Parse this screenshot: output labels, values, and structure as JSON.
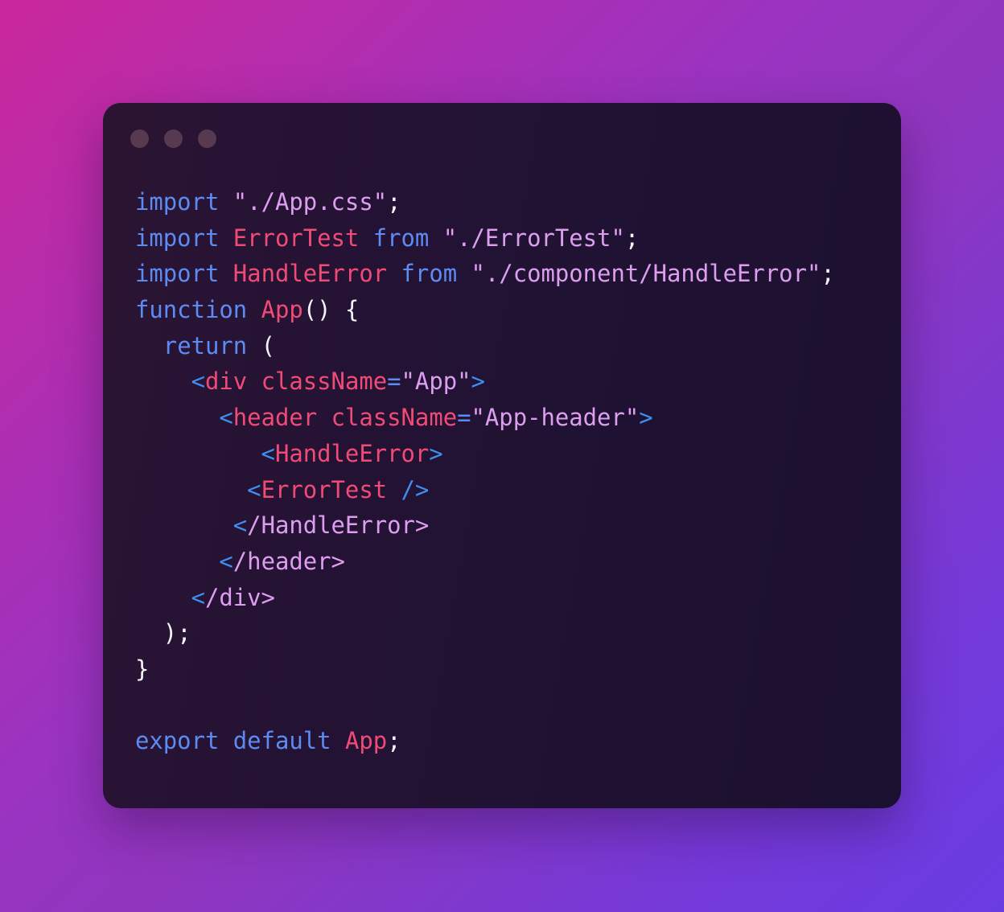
{
  "window": {
    "dots": [
      "close-dot",
      "minimize-dot",
      "maximize-dot"
    ],
    "dot_color": "#573a50"
  },
  "theme": {
    "background_gradient_start": "#c9279b",
    "background_gradient_end": "#693ce2",
    "card_background": "#221233",
    "keyword_color": "#5d8bf4",
    "identifier_color": "#f04b77",
    "string_color": "#dd9ef0",
    "punctuation_color": "#f4f4f8",
    "bracket_color": "#3f8ef0",
    "closing_tag_color": "#dd9ef0"
  },
  "code": {
    "language": "jsx",
    "plain_text": "import \"./App.css\";\nimport ErrorTest from \"./ErrorTest\";\nimport HandleError from \"./component/HandleError\";\nfunction App() {\n  return (\n    <div className=\"App\">\n      <header className=\"App-header\">\n         <HandleError>\n        <ErrorTest />\n       </HandleError>\n      </header>\n    </div>\n  );\n}\n\nexport default App;",
    "lines": [
      {
        "id": "line-1",
        "indent": "",
        "tokens": [
          {
            "t": "import",
            "c": "tok-keyword"
          },
          {
            "t": " ",
            "c": "tok-plain"
          },
          {
            "t": "\"./App.css\"",
            "c": "tok-string"
          },
          {
            "t": ";",
            "c": "tok-punct"
          }
        ]
      },
      {
        "id": "line-2",
        "indent": "",
        "tokens": [
          {
            "t": "import",
            "c": "tok-keyword"
          },
          {
            "t": " ",
            "c": "tok-plain"
          },
          {
            "t": "ErrorTest",
            "c": "tok-ident"
          },
          {
            "t": " ",
            "c": "tok-plain"
          },
          {
            "t": "from",
            "c": "tok-keyword"
          },
          {
            "t": " ",
            "c": "tok-plain"
          },
          {
            "t": "\"./ErrorTest\"",
            "c": "tok-string"
          },
          {
            "t": ";",
            "c": "tok-punct"
          }
        ]
      },
      {
        "id": "line-3",
        "indent": "",
        "tokens": [
          {
            "t": "import",
            "c": "tok-keyword"
          },
          {
            "t": " ",
            "c": "tok-plain"
          },
          {
            "t": "HandleError",
            "c": "tok-ident"
          },
          {
            "t": " ",
            "c": "tok-plain"
          },
          {
            "t": "from",
            "c": "tok-keyword"
          },
          {
            "t": " ",
            "c": "tok-plain"
          },
          {
            "t": "\"./component/HandleError\"",
            "c": "tok-string"
          },
          {
            "t": ";",
            "c": "tok-punct"
          }
        ]
      },
      {
        "id": "line-4",
        "indent": "",
        "tokens": [
          {
            "t": "function",
            "c": "tok-keyword"
          },
          {
            "t": " ",
            "c": "tok-plain"
          },
          {
            "t": "App",
            "c": "tok-ident"
          },
          {
            "t": "() {",
            "c": "tok-punct"
          }
        ]
      },
      {
        "id": "line-5",
        "indent": "  ",
        "tokens": [
          {
            "t": "return",
            "c": "tok-keyword"
          },
          {
            "t": " ",
            "c": "tok-plain"
          },
          {
            "t": "(",
            "c": "tok-punct"
          }
        ]
      },
      {
        "id": "line-6",
        "indent": "    ",
        "tokens": [
          {
            "t": "<",
            "c": "tok-bracket"
          },
          {
            "t": "div",
            "c": "tok-tag"
          },
          {
            "t": " ",
            "c": "tok-plain"
          },
          {
            "t": "className",
            "c": "tok-attr"
          },
          {
            "t": "=",
            "c": "tok-equals"
          },
          {
            "t": "\"App\"",
            "c": "tok-string"
          },
          {
            "t": ">",
            "c": "tok-bracket"
          }
        ]
      },
      {
        "id": "line-7",
        "indent": "      ",
        "tokens": [
          {
            "t": "<",
            "c": "tok-bracket"
          },
          {
            "t": "header",
            "c": "tok-tag"
          },
          {
            "t": " ",
            "c": "tok-plain"
          },
          {
            "t": "className",
            "c": "tok-attr"
          },
          {
            "t": "=",
            "c": "tok-equals"
          },
          {
            "t": "\"App-header\"",
            "c": "tok-string"
          },
          {
            "t": ">",
            "c": "tok-bracket"
          }
        ]
      },
      {
        "id": "line-8",
        "indent": "         ",
        "tokens": [
          {
            "t": "<",
            "c": "tok-bracket"
          },
          {
            "t": "HandleError",
            "c": "tok-tag"
          },
          {
            "t": ">",
            "c": "tok-bracket"
          }
        ]
      },
      {
        "id": "line-9",
        "indent": "        ",
        "tokens": [
          {
            "t": "<",
            "c": "tok-bracket"
          },
          {
            "t": "ErrorTest",
            "c": "tok-tag"
          },
          {
            "t": " ",
            "c": "tok-plain"
          },
          {
            "t": "/>",
            "c": "tok-bracket"
          }
        ]
      },
      {
        "id": "line-10",
        "indent": "       ",
        "tokens": [
          {
            "t": "<",
            "c": "tok-bracket"
          },
          {
            "t": "/HandleError>",
            "c": "tok-closetag"
          }
        ]
      },
      {
        "id": "line-11",
        "indent": "      ",
        "tokens": [
          {
            "t": "<",
            "c": "tok-bracket"
          },
          {
            "t": "/header>",
            "c": "tok-closetag"
          }
        ]
      },
      {
        "id": "line-12",
        "indent": "    ",
        "tokens": [
          {
            "t": "<",
            "c": "tok-bracket"
          },
          {
            "t": "/div>",
            "c": "tok-closetag"
          }
        ]
      },
      {
        "id": "line-13",
        "indent": "  ",
        "tokens": [
          {
            "t": ");",
            "c": "tok-punct"
          }
        ]
      },
      {
        "id": "line-14",
        "indent": "",
        "tokens": [
          {
            "t": "}",
            "c": "tok-punct"
          }
        ]
      },
      {
        "id": "line-15",
        "indent": "",
        "tokens": []
      },
      {
        "id": "line-16",
        "indent": "",
        "tokens": [
          {
            "t": "export",
            "c": "tok-keyword"
          },
          {
            "t": " ",
            "c": "tok-plain"
          },
          {
            "t": "default",
            "c": "tok-keyword"
          },
          {
            "t": " ",
            "c": "tok-plain"
          },
          {
            "t": "App",
            "c": "tok-ident"
          },
          {
            "t": ";",
            "c": "tok-punct"
          }
        ]
      }
    ]
  }
}
